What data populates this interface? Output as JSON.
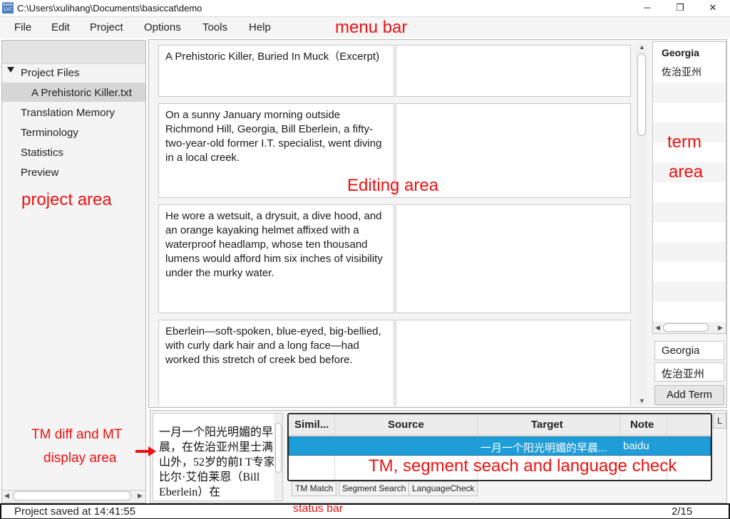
{
  "window": {
    "title": "C:\\Users\\xulihang\\Documents\\basiccat\\demo",
    "icon_text": "basic CAT",
    "minimize_glyph": "─",
    "maximize_glyph": "❐",
    "close_glyph": "✕"
  },
  "menu": {
    "items": [
      "File",
      "Edit",
      "Project",
      "Options",
      "Tools",
      "Help"
    ]
  },
  "project": {
    "tree": [
      {
        "label": "Project Files",
        "expanded": true
      },
      {
        "label": "A Prehistoric Killer.txt",
        "selected": true
      },
      {
        "label": "Translation Memory"
      },
      {
        "label": "Terminology"
      },
      {
        "label": "Statistics"
      },
      {
        "label": "Preview"
      }
    ]
  },
  "segments": [
    {
      "source": "A Prehistoric Killer, Buried In Muck（Excerpt)",
      "target": ""
    },
    {
      "source": "On a sunny January morning outside Richmond Hill, Georgia, Bill Eberlein, a fifty-two-year-old former I.T. specialist, went diving in a local creek.",
      "target": ""
    },
    {
      "source": "He wore a wetsuit, a drysuit, a dive hood, and an orange kayaking helmet affixed with a waterproof headlamp, whose ten thousand lumens would afford him six inches of visibility under the murky water.",
      "target": ""
    },
    {
      "source": "Eberlein—soft-spoken, blue-eyed, big-bellied, with curly dark hair and a long face—had worked this stretch of creek bed before.",
      "target": ""
    }
  ],
  "terms": {
    "entries": [
      {
        "source": "Georgia",
        "target": "佐治亚州"
      }
    ],
    "source_field": "Georgia",
    "target_field": "佐治亚州",
    "add_button": "Add Term"
  },
  "mt_display": {
    "text": "一月一个阳光明媚的早晨，在佐治亚州里士满山外，52岁的前I T专家比尔·艾伯莱恩（Bill Eberlein）在"
  },
  "tm_table": {
    "columns": [
      "Simil...",
      "Source",
      "Target",
      "Note"
    ],
    "rows": [
      {
        "similarity": "",
        "source": "",
        "target": "一月一个阳光明媚的早晨...",
        "note": "baidu",
        "selected": true
      }
    ],
    "tabs": [
      "TM Match",
      "Segment Search",
      "LanguageCheck"
    ],
    "side_tab": "L"
  },
  "status": {
    "message": "Project saved at 14:41:55",
    "page": "2/15"
  },
  "annotations": {
    "menu_bar": "menu bar",
    "editing_area": "Editing area",
    "project_area": "project area",
    "term_line1": "term",
    "term_line2": "area",
    "tm_diff_line1": "TM diff and MT",
    "tm_diff_line2": "display area",
    "tm_search": "TM, segment seach and language check",
    "status_bar": "status bar",
    "color": "#ee1111"
  }
}
